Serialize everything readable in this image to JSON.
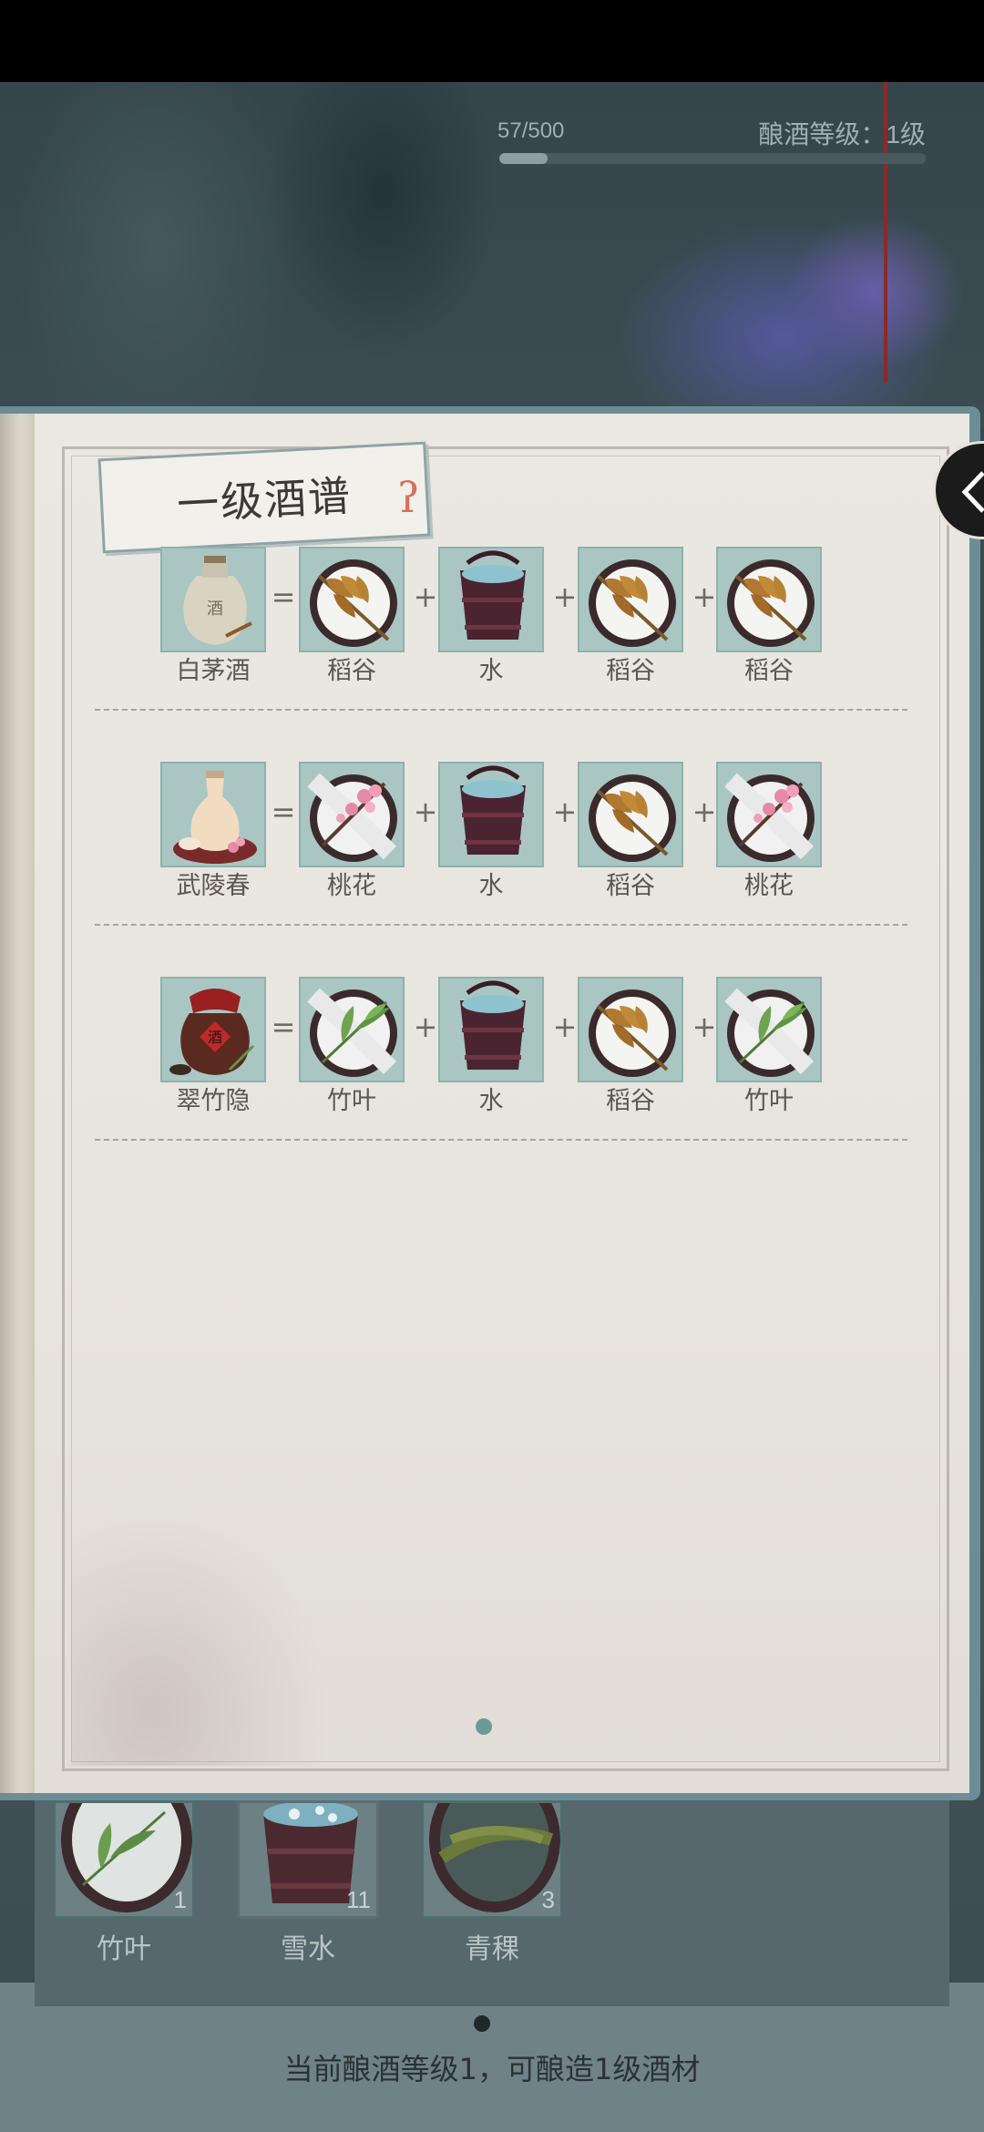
{
  "header": {
    "exp_text": "57/500",
    "level_text": "酿酒等级：1级",
    "exp_progress": 0.114
  },
  "book": {
    "title": "一级酒谱",
    "page_indicator": "1 of 1",
    "recipes": [
      {
        "result": "白茅酒",
        "result_icon": "white-jar-icon",
        "ingredients": [
          "稻谷",
          "水",
          "稻谷",
          "稻谷"
        ],
        "ingredient_icons": [
          "rice-icon",
          "water-bucket-icon",
          "rice-icon",
          "rice-icon"
        ]
      },
      {
        "result": "武陵春",
        "result_icon": "sake-bottle-icon",
        "ingredients": [
          "桃花",
          "水",
          "稻谷",
          "桃花"
        ],
        "ingredient_icons": [
          "peach-blossom-icon",
          "water-bucket-icon",
          "rice-icon",
          "peach-blossom-icon"
        ]
      },
      {
        "result": "翠竹隐",
        "result_icon": "red-jar-icon",
        "ingredients": [
          "竹叶",
          "水",
          "稻谷",
          "竹叶"
        ],
        "ingredient_icons": [
          "bamboo-leaf-icon",
          "water-bucket-icon",
          "rice-icon",
          "bamboo-leaf-icon"
        ]
      }
    ],
    "equals_sign": "=",
    "plus_sign": "+"
  },
  "inventory": {
    "items": [
      {
        "name": "竹叶",
        "count": "1",
        "icon": "bamboo-leaf-icon"
      },
      {
        "name": "雪水",
        "count": "11",
        "icon": "snow-water-bucket-icon"
      },
      {
        "name": "青稞",
        "count": "3",
        "icon": "barley-icon"
      }
    ]
  },
  "footer": {
    "message": "当前酿酒等级1，可酿造1级酒材"
  },
  "colors": {
    "tile_bg": "#a9c6c3",
    "page_bg": "#ebe7e1",
    "accent": "#d86f5c"
  }
}
